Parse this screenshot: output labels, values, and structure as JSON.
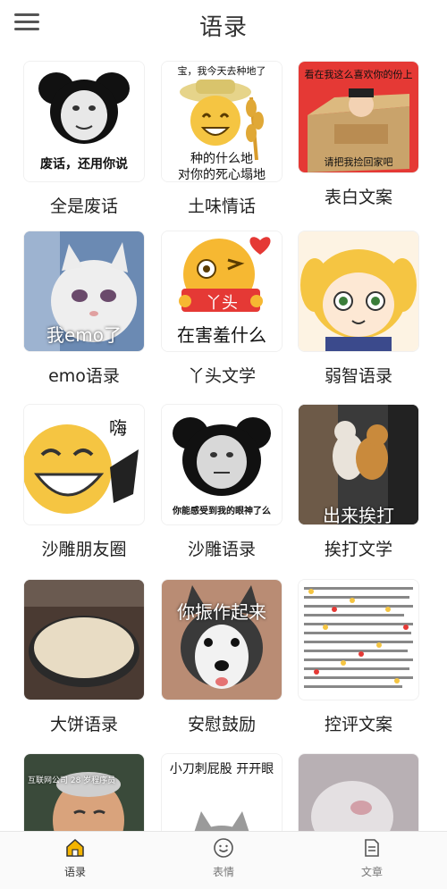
{
  "header": {
    "title": "语录"
  },
  "cards": [
    {
      "label": "全是废话",
      "caption": "废话，还用你说"
    },
    {
      "label": "土味情话",
      "caption_top": "宝，我今天去种地了",
      "caption_mid": "种的什么地",
      "caption_bottom": "对你的死心塌地"
    },
    {
      "label": "表白文案",
      "caption_top": "看在我这么喜欢你的份上",
      "caption_bottom": "请把我捡回家吧"
    },
    {
      "label": "emo语录",
      "caption": "我emo了"
    },
    {
      "label": "丫头文学",
      "caption_mid": "丫头",
      "caption_bottom": "在害羞什么"
    },
    {
      "label": "弱智语录"
    },
    {
      "label": "沙雕朋友圈",
      "caption": "嗨"
    },
    {
      "label": "沙雕语录",
      "caption": "你能感受到我的眼神了么"
    },
    {
      "label": "挨打文学",
      "caption": "出来挨打"
    },
    {
      "label": "大饼语录"
    },
    {
      "label": "安慰鼓励",
      "caption": "你振作起来"
    },
    {
      "label": "控评文案"
    },
    {
      "label": "",
      "caption": "互联网公司 28 岁程序员"
    },
    {
      "label": "",
      "caption": "小刀刺屁股 开开眼"
    },
    {
      "label": ""
    }
  ],
  "nav": [
    {
      "label": "语录",
      "icon": "home-icon"
    },
    {
      "label": "表情",
      "icon": "smiley-icon"
    },
    {
      "label": "文章",
      "icon": "document-icon"
    }
  ],
  "colors": {
    "active_icon": "#f4b400",
    "text": "#222222"
  }
}
